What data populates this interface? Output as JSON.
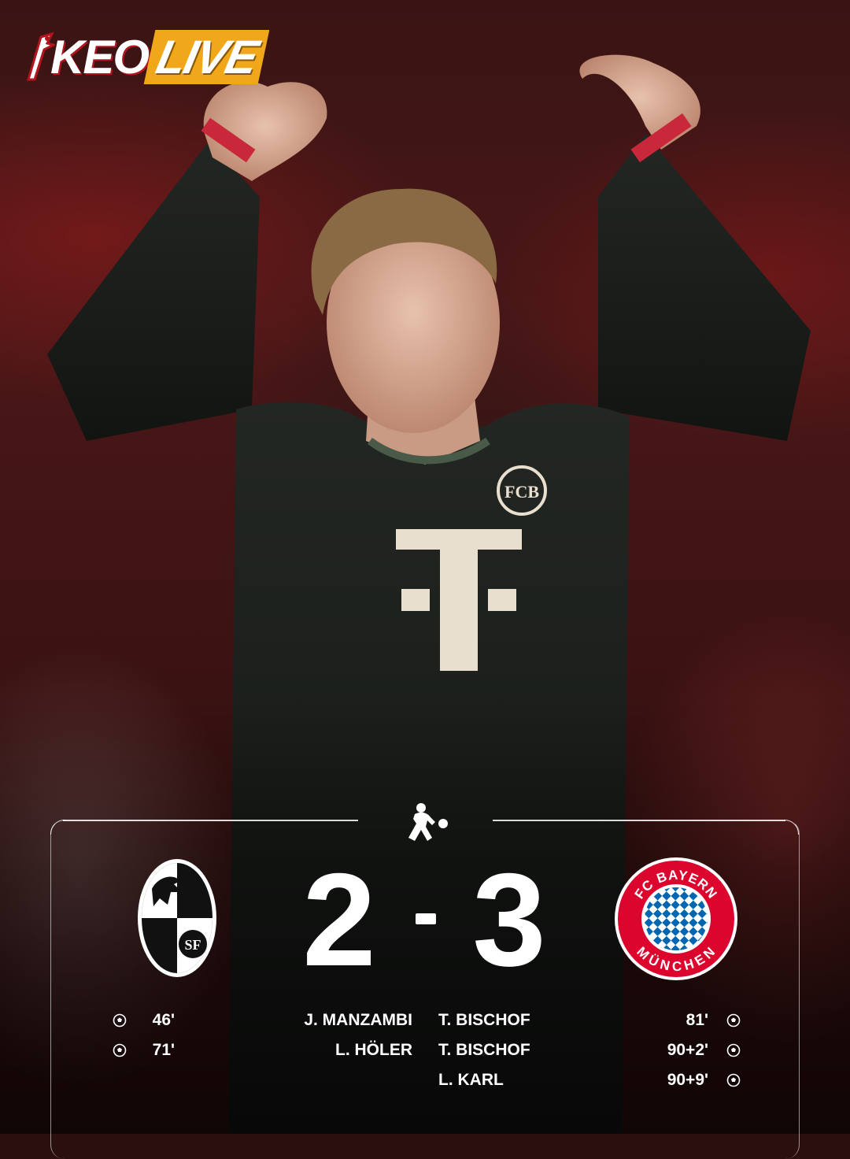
{
  "brand": {
    "logo_text": "KEOLIVE",
    "part_one": "KEO",
    "part_two": "LIVE",
    "colors": {
      "red": "#b4141e",
      "gold": "#f0a81a"
    }
  },
  "match": {
    "league_icon": "bundesliga-logo-icon",
    "home": {
      "crest_icon": "sc-freiburg-crest-icon",
      "crest_text": "SF",
      "score": "2"
    },
    "away": {
      "crest_icon": "fc-bayern-munchen-crest-icon",
      "crest_text_top": "FC BAYERN",
      "crest_text_bottom": "MÜNCHEN",
      "score": "3"
    },
    "separator": "-"
  },
  "goals": {
    "home": [
      {
        "player": "J. MANZAMBI",
        "minute": "46'"
      },
      {
        "player": "L. HÖLER",
        "minute": "71'"
      }
    ],
    "away": [
      {
        "player": "T. BISCHOF",
        "minute": "81'"
      },
      {
        "player": "T. BISCHOF",
        "minute": "90+2'"
      },
      {
        "player": "L. KARL",
        "minute": "90+9'"
      }
    ],
    "ball_icon": "soccer-ball-icon"
  },
  "photo": {
    "shirt_sponsor_mark": "T",
    "colors": {
      "shirt": "#1c1f1c",
      "sponsor": "#e9dfcf",
      "trim": "#c8283a"
    }
  }
}
